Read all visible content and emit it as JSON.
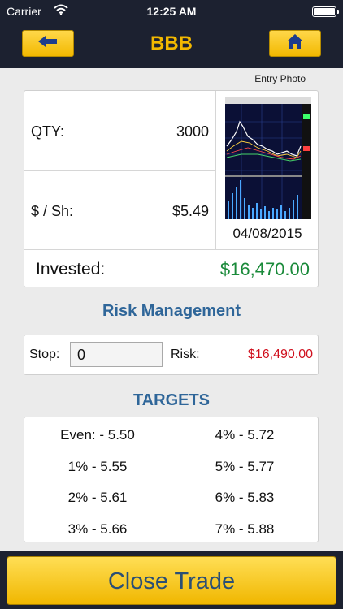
{
  "status_bar": {
    "carrier": "Carrier",
    "time": "12:25 AM",
    "wifi_icon": "wifi-icon",
    "battery_icon": "battery-icon"
  },
  "nav": {
    "title": "BBB",
    "back_icon": "back-arrow-icon",
    "home_icon": "home-icon",
    "accent_color": "#f2b800"
  },
  "entry_photo": {
    "label": "Entry Photo",
    "date": "04/08/2015"
  },
  "position": {
    "qty_label": "QTY:",
    "qty_value": "3000",
    "price_label": "$ / Sh:",
    "price_value": "$5.49",
    "invested_label": "Invested:",
    "invested_value": "$16,470.00",
    "invested_color": "#1a8a3a"
  },
  "risk": {
    "title": "Risk Management",
    "stop_label": "Stop:",
    "stop_value": "0",
    "risk_label": "Risk:",
    "risk_value": "$16,490.00",
    "risk_color": "#d0101e"
  },
  "targets": {
    "title": "TARGETS",
    "items": [
      "Even: - 5.50",
      "4% - 5.72",
      "1% - 5.55",
      "5% - 5.77",
      "2% - 5.61",
      "6% - 5.83",
      "3% - 5.66",
      "7% - 5.88"
    ]
  },
  "actions": {
    "close_trade_label": "Close Trade"
  }
}
